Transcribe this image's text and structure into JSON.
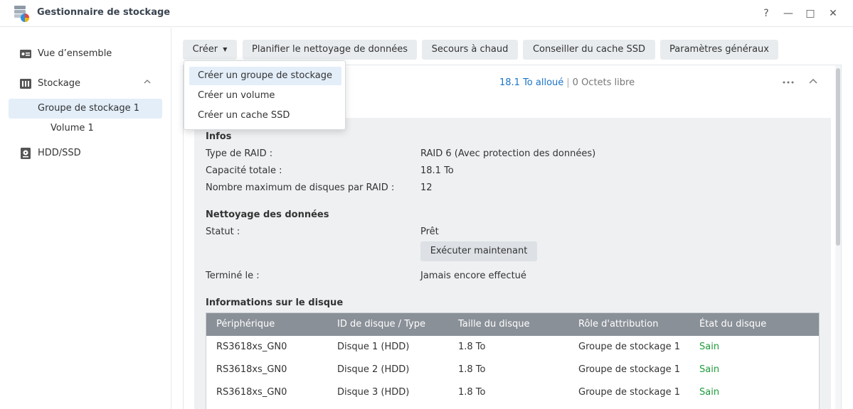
{
  "window": {
    "title": "Gestionnaire de stockage",
    "help": "?",
    "minimize": "—",
    "maximize": "□",
    "close": "✕"
  },
  "sidebar": {
    "overview": "Vue d’ensemble",
    "storage": "Stockage",
    "pool": "Groupe de stockage 1",
    "volume": "Volume 1",
    "hdd": "HDD/SSD"
  },
  "toolbar": {
    "create": "Créer",
    "schedule": "Planifier le nettoyage de données",
    "hotspare": "Secours à chaud",
    "ssd_advisor": "Conseiller du cache SSD",
    "settings": "Paramètres généraux"
  },
  "dropdown": [
    "Créer un groupe de stockage",
    "Créer un volume",
    "Créer un cache SSD"
  ],
  "summary": {
    "allocated": "18.1 To alloué",
    "separator": "|",
    "free": "0 Octets libre"
  },
  "info": {
    "title": "Infos",
    "raid_type_label": "Type de RAID :",
    "raid_type_value": "RAID 6 (Avec protection des données)",
    "capacity_label": "Capacité totale :",
    "capacity_value": "18.1 To",
    "max_disks_label": "Nombre maximum de disques par RAID :",
    "max_disks_value": "12"
  },
  "scrub": {
    "title": "Nettoyage des données",
    "status_label": "Statut :",
    "status_value": "Prêt",
    "run_button": "Exécuter maintenant",
    "finished_label": "Terminé le :",
    "finished_value": "Jamais encore effectué"
  },
  "disks": {
    "title": "Informations sur le disque",
    "headers": [
      "Périphérique",
      "ID de disque / Type",
      "Taille du disque",
      "Rôle d'attribution",
      "État du disque"
    ],
    "rows": [
      [
        "RS3618xs_GN0",
        "Disque 1 (HDD)",
        "1.8 To",
        "Groupe de stockage 1",
        "Sain"
      ],
      [
        "RS3618xs_GN0",
        "Disque 2 (HDD)",
        "1.8 To",
        "Groupe de stockage 1",
        "Sain"
      ],
      [
        "RS3618xs_GN0",
        "Disque 3 (HDD)",
        "1.8 To",
        "Groupe de stockage 1",
        "Sain"
      ]
    ]
  },
  "colors": {
    "accent": "#1a73c8",
    "healthy": "#1f9b3b",
    "table_header": "#8a9098",
    "selection": "#e3eef9"
  }
}
